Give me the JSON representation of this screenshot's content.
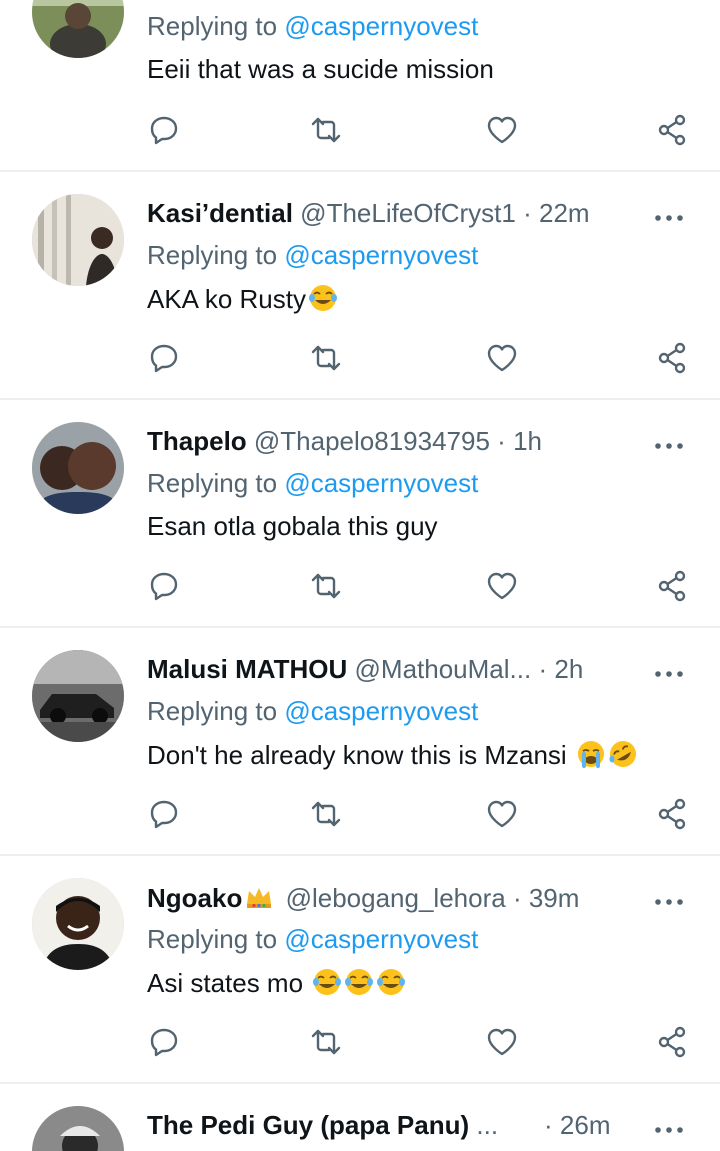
{
  "tweets": [
    {
      "name": "",
      "handle": "",
      "time": "",
      "replying_prefix": "Replying to ",
      "replying_to": "@caspernyovest",
      "text": "Eeii that was a sucide mission",
      "emojis": []
    },
    {
      "name": "Kasi’dential",
      "handle": "@TheLifeOfCryst1",
      "time": "22m",
      "replying_prefix": "Replying to ",
      "replying_to": "@caspernyovest",
      "text": "AKA ko Rusty",
      "emojis": [
        "face-with-tears-of-joy"
      ]
    },
    {
      "name": "Thapelo",
      "handle": "@Thapelo81934795",
      "time": "1h",
      "replying_prefix": "Replying to ",
      "replying_to": "@caspernyovest",
      "text": "Esan otla gobala this guy",
      "emojis": []
    },
    {
      "name": "Malusi MATHOU",
      "handle": "@MathouMal...",
      "time": "2h",
      "replying_prefix": "Replying to ",
      "replying_to": "@caspernyovest",
      "text": "Don't he already know this is Mzansi ",
      "emojis": [
        "loudly-crying-face",
        "rolling-on-floor-laughing"
      ]
    },
    {
      "name": "Ngoako",
      "name_emoji": "crown",
      "handle": "@lebogang_lehora",
      "time": "39m",
      "replying_prefix": "Replying to ",
      "replying_to": "@caspernyovest",
      "text": "Asi states mo ",
      "emojis": [
        "face-with-tears-of-joy",
        "face-with-tears-of-joy",
        "face-with-tears-of-joy"
      ]
    },
    {
      "name": "The Pedi Guy (papa Panu)",
      "name_truncation": "...",
      "handle": "",
      "time": "26m"
    }
  ],
  "time_separator": "·",
  "icons": {
    "reply": "reply-icon",
    "retweet": "retweet-icon",
    "like": "like-icon",
    "share": "share-icon",
    "more": "more-icon"
  },
  "colors": {
    "text": "#0f1419",
    "secondary": "#536471",
    "link": "#1d9bf0",
    "divider": "#eceff1"
  }
}
